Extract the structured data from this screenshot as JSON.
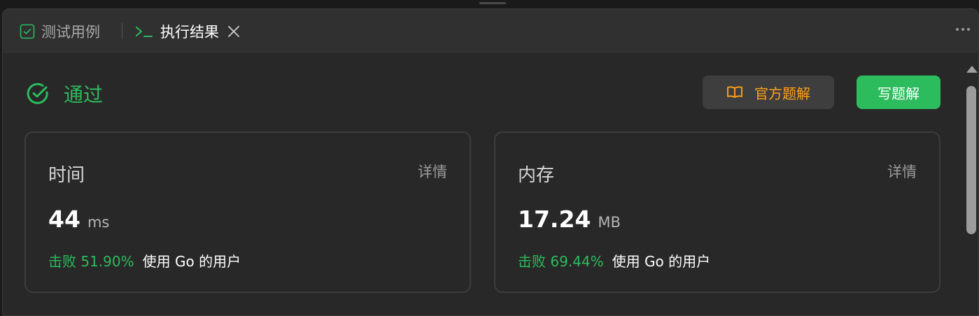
{
  "tabs": {
    "testcase_label": "测试用例",
    "result_label": "执行结果"
  },
  "status": {
    "label": "通过",
    "color": "#2cbb5d"
  },
  "actions": {
    "official_solution_label": "官方题解",
    "write_solution_label": "写题解"
  },
  "runtime": {
    "title": "时间",
    "detail_label": "详情",
    "value": "44",
    "unit": "ms",
    "beats": "击败 51.90%",
    "users_text": "使用 Go 的用户"
  },
  "memory": {
    "title": "内存",
    "detail_label": "详情",
    "value": "17.24",
    "unit": "MB",
    "beats": "击败 69.44%",
    "users_text": "使用 Go 的用户"
  },
  "colors": {
    "accent_green": "#2cbb5d",
    "accent_orange": "#ffa116",
    "panel_bg": "#282828"
  },
  "icons": [
    "checkbox-check-icon",
    "terminal-icon",
    "close-icon",
    "more-icon",
    "check-circle-icon",
    "book-icon"
  ]
}
